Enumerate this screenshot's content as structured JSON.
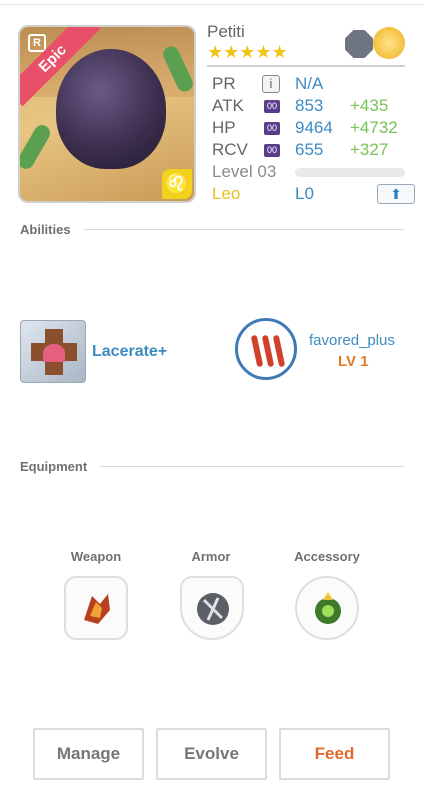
{
  "monster": {
    "name": "Petiti",
    "stars": "★★★★★",
    "rarity": "Epic",
    "badge": "R",
    "zodiac_symbol": "♌"
  },
  "stats": {
    "pr": {
      "label": "PR",
      "value": "N/A",
      "info_glyph": "i"
    },
    "atk": {
      "label": "ATK",
      "plus": "00",
      "value": "853",
      "bonus": "+435"
    },
    "hp": {
      "label": "HP",
      "plus": "00",
      "value": "9464",
      "bonus": "+4732"
    },
    "rcv": {
      "label": "RCV",
      "plus": "00",
      "value": "655",
      "bonus": "+327"
    },
    "level": {
      "label": "Level 03",
      "xp_fraction": 0.0
    },
    "zodiac": {
      "label": "Leo",
      "value": "L0",
      "upgrade_glyph": "⬆"
    }
  },
  "abilities": {
    "title": "Abilities",
    "active": {
      "name": "Lacerate+"
    },
    "leader": {
      "name": "favored_plus",
      "level": "LV 1"
    }
  },
  "equipment": {
    "title": "Equipment",
    "slots": [
      {
        "label": "Weapon"
      },
      {
        "label": "Armor"
      },
      {
        "label": "Accessory"
      }
    ]
  },
  "actions": {
    "manage": "Manage",
    "evolve": "Evolve",
    "feed": "Feed"
  },
  "colors": {
    "accent_blue": "#3c8bc4",
    "bonus_green": "#79c255",
    "feed_orange": "#e06a2e",
    "star_gold": "#f2c41a",
    "epic_pink": "#e8506a"
  },
  "icons": [
    "r-badge-icon",
    "leo-zodiac-icon",
    "evo-stone-icon",
    "evo-flower-icon",
    "info-icon",
    "upgrade-arrow-icon",
    "lacerate-icon",
    "claw-icon",
    "weapon-icon",
    "armor-icon",
    "accessory-icon"
  ]
}
